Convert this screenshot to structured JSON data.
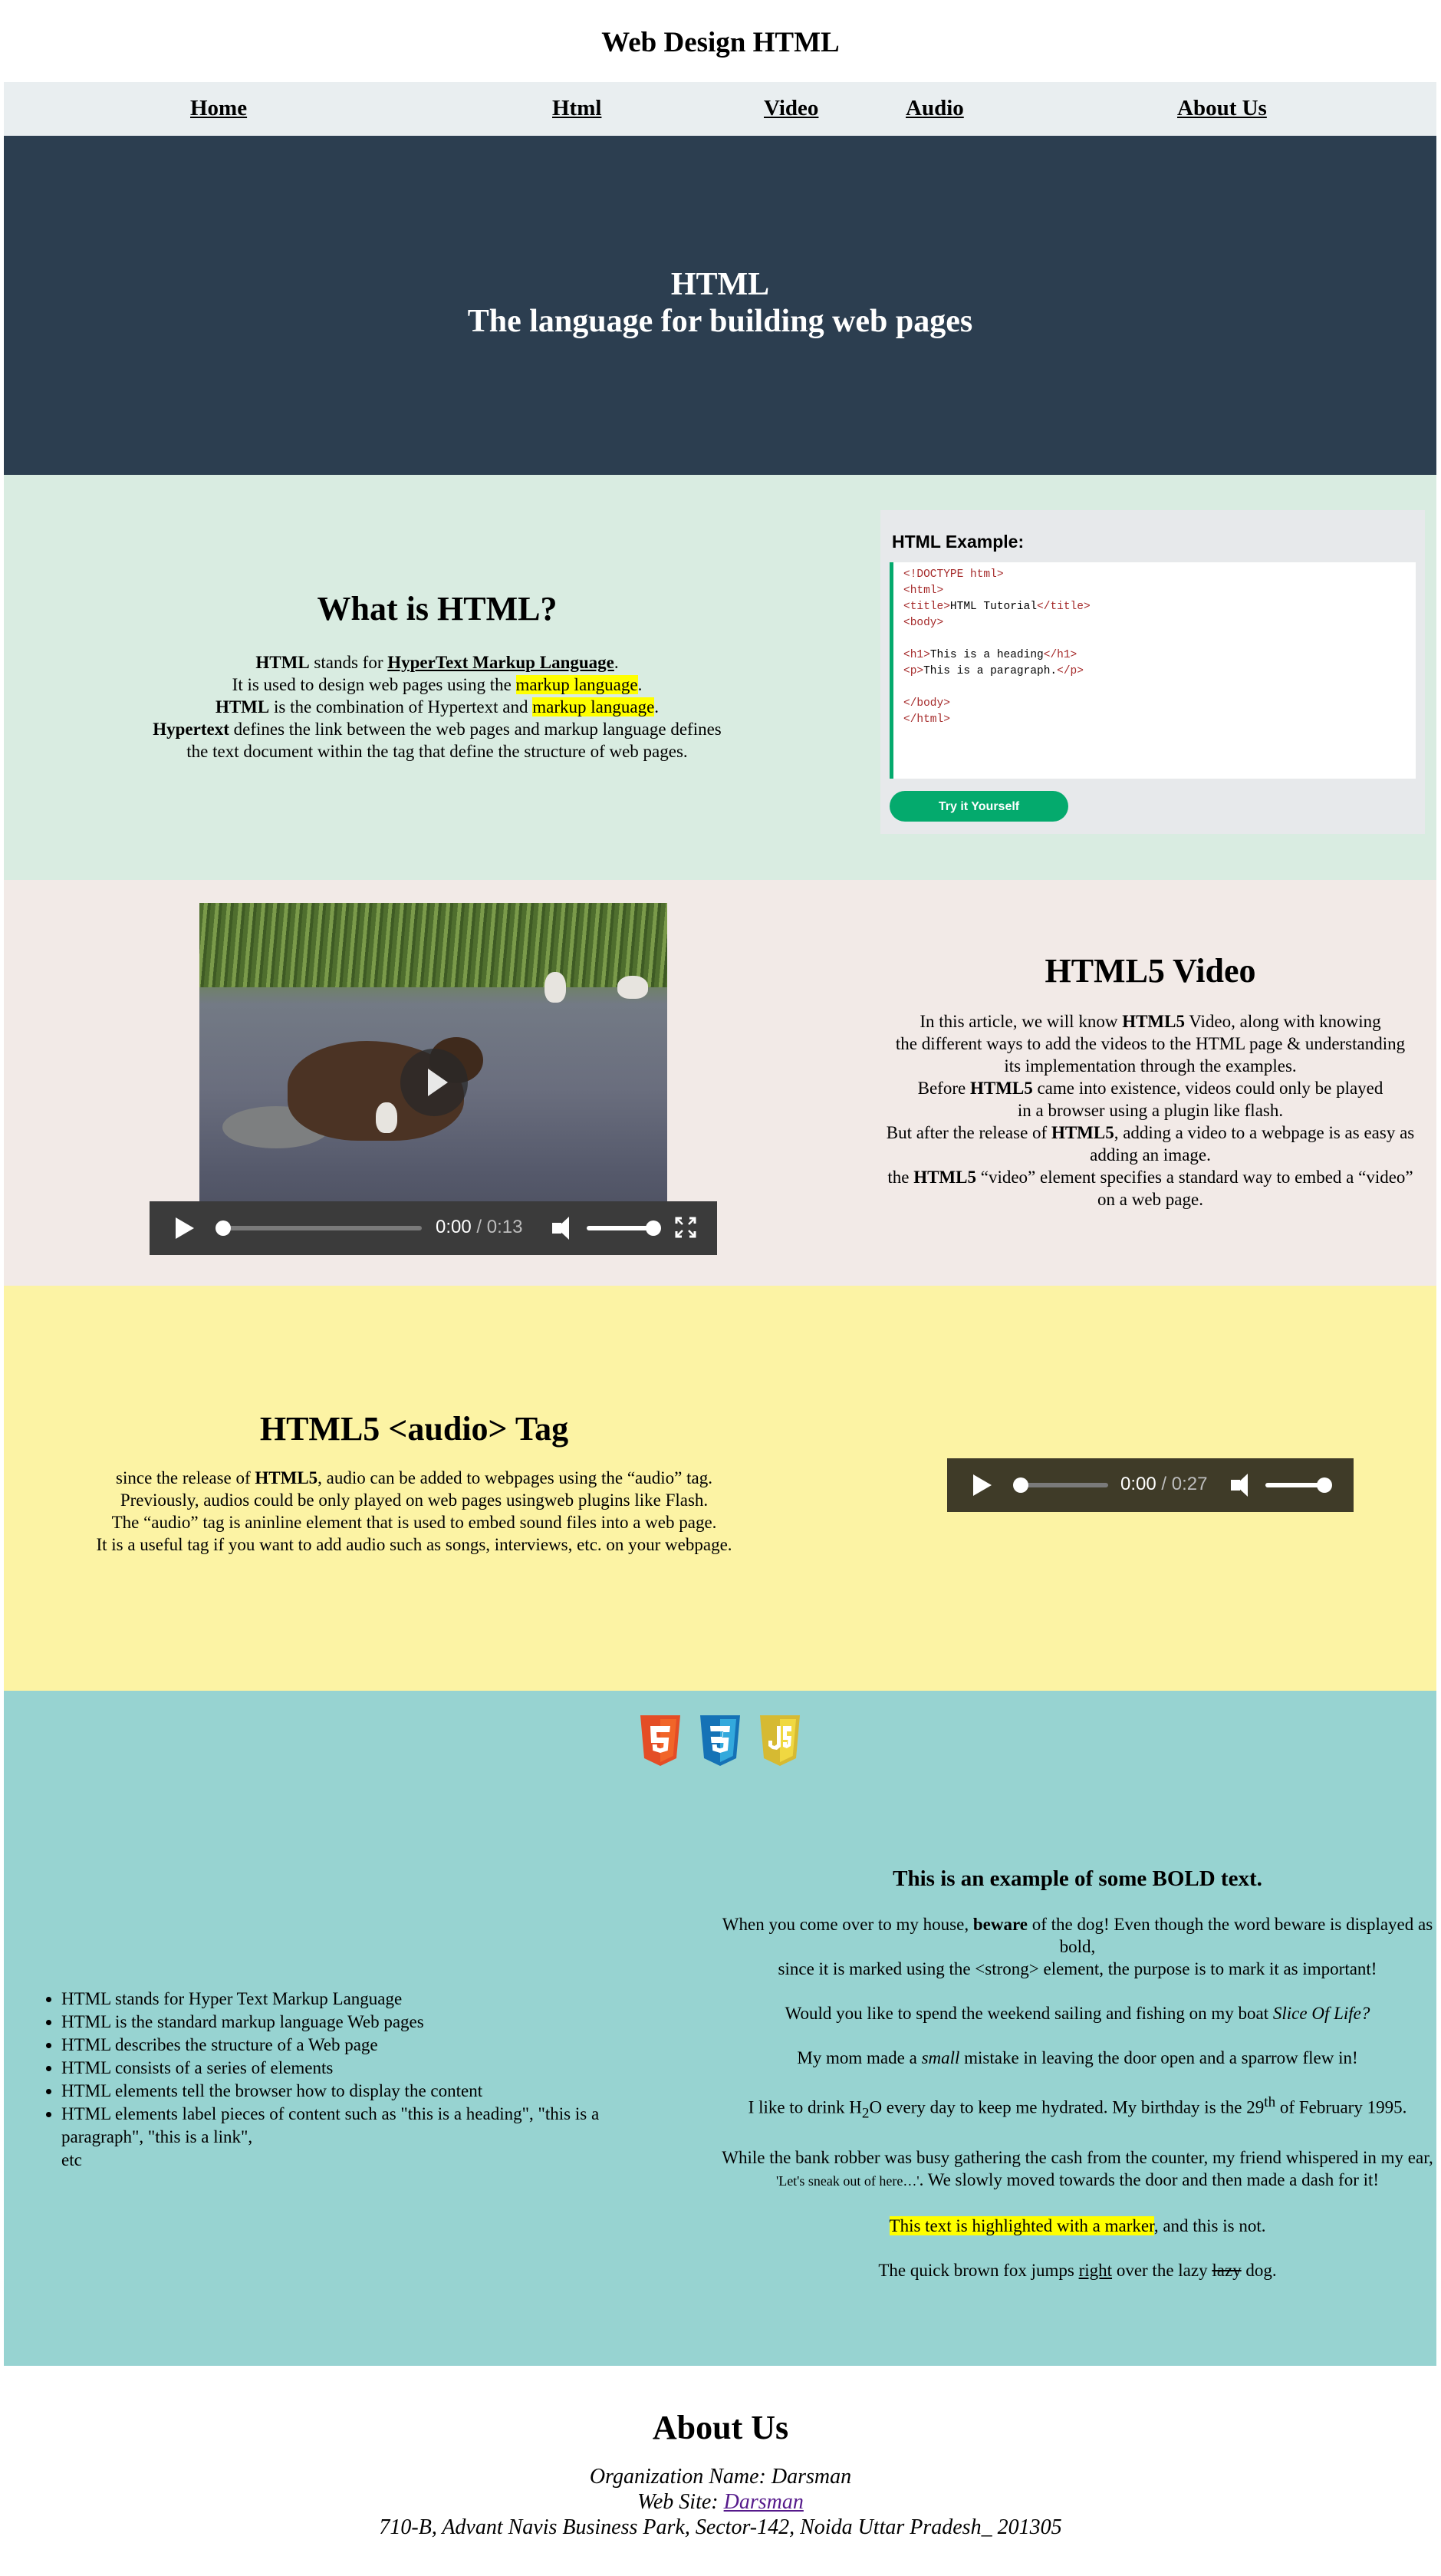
{
  "site_title": "Web Design HTML",
  "nav": {
    "home": "Home",
    "html": "Html",
    "video": "Video",
    "audio": "Audio",
    "about": "About Us"
  },
  "hero": {
    "line1": "HTML",
    "line2": "The language for building web pages"
  },
  "what": {
    "heading": "What is HTML?",
    "l1_b": "HTML",
    "l1_t": " stands for ",
    "l1_u": "HyperText Markup Language",
    "l1_end": ".",
    "l2_t": "It is used to design web pages using the ",
    "l2_hl": "markup language",
    "l2_end": ".",
    "l3_b": "HTML",
    "l3_t": " is the combination of Hypertext and ",
    "l3_hl": "markup language",
    "l3_end": ".",
    "l4_b": "Hypertext",
    "l4_t": " defines the link between the web pages and markup language defines",
    "l5_t": "the text document within the tag that define the structure of web pages."
  },
  "example": {
    "title": "HTML Example:",
    "code": [
      {
        "tag": "<!DOCTYPE html>",
        "text": ""
      },
      {
        "tag": "<html>",
        "text": ""
      },
      {
        "open": "<title>",
        "text": "HTML Tutorial",
        "close": "</title>"
      },
      {
        "tag": "<body>",
        "text": ""
      },
      {
        "tag": "",
        "text": ""
      },
      {
        "open": "<h1>",
        "text": "This is a heading",
        "close": "</h1>"
      },
      {
        "open": "<p>",
        "text": "This is a paragraph.",
        "close": "</p>"
      },
      {
        "tag": "",
        "text": ""
      },
      {
        "tag": "</body>",
        "text": ""
      },
      {
        "tag": "</html>",
        "text": ""
      }
    ],
    "button": "Try it Yourself"
  },
  "video": {
    "heading": "HTML5 Video",
    "current": "0:00",
    "duration": "0:13",
    "p1a": "In this article, we will know ",
    "p1b": "HTML5",
    "p1c": " Video, along with knowing",
    "p2": "the different ways to add the videos to the HTML page & understanding",
    "p3": "its implementation through the examples.",
    "p4a": "Before ",
    "p4b": "HTML5",
    "p4c": " came into existence, videos could only be played",
    "p5": "in a browser using a plugin like flash.",
    "p6a": "But after the release of ",
    "p6b": "HTML5",
    "p6c": ", adding a video to a webpage is as easy as",
    "p7": "adding an image.",
    "p8a": "the ",
    "p8b": "HTML5",
    "p8c": " “video” element specifies a standard way to embed a “video”",
    "p9": "on a web page."
  },
  "audio": {
    "heading": "HTML5 <audio> Tag",
    "current": "0:00",
    "duration": "0:27",
    "p1a": "since the release of ",
    "p1b": "HTML5",
    "p1c": ", audio can be added to webpages using the “audio” tag.",
    "p2": "Previously, audios could be only played on web pages usingweb plugins like Flash.",
    "p3": "The “audio” tag is aninline element that is used to embed sound files into a web page.",
    "p4": "It is a useful tag if you want to add audio such as songs, interviews, etc. on your webpage."
  },
  "logos": [
    "html5-logo",
    "css3-logo",
    "javascript-logo"
  ],
  "list": {
    "items": [
      "HTML stands for Hyper Text Markup Language",
      "HTML is the standard markup language Web pages",
      "HTML describes the structure of a Web page",
      "HTML consists of a series of elements",
      "HTML elements tell the browser how to display the content",
      "HTML elements label pieces of content such as \"this is a heading\", \"this is a paragraph\", \"this is a link\","
    ],
    "trailing": "etc"
  },
  "bold_section": {
    "heading": "This is an example of some BOLD text.",
    "p1a": "When you come over to my house, ",
    "p1b": "beware",
    "p1c": " of the dog! Even though the word beware is displayed as bold,",
    "p1d": "since it is marked using the <strong> element, the purpose is to mark it as important!",
    "p2a": "Would you like to spend the weekend sailing and fishing on my boat ",
    "p2b": "Slice Of Life?",
    "p3a": "My mom made a ",
    "p3b": "small",
    "p3c": " mistake in leaving the door open and a sparrow flew in!",
    "p4a": "I like to drink H",
    "p4sub": "2",
    "p4b": "O every day to keep me hydrated. My birthday is the 29",
    "p4sup": "th",
    "p4c": " of February 1995.",
    "p5a": "While the bank robber was busy gathering the cash from the counter, my friend whispered in my ear,",
    "p5b": "'Let's sneak out of here…'",
    "p5c": ". We slowly moved towards the door and then made a dash for it!",
    "p6a": "This text is highlighted with a marker",
    "p6b": ", and this is not.",
    "p7a": "The quick brown fox jumps ",
    "p7b": "right",
    "p7c": " over the lazy ",
    "p7d": "lazy",
    "p7e": " dog."
  },
  "about": {
    "heading": "About Us",
    "org": "Organization Name: Darsman",
    "web_label": "Web Site: ",
    "web_link": "Darsman",
    "address": "710-B, Advant Navis Business Park, Sector-142, Noida Uttar Pradesh_ 201305"
  }
}
